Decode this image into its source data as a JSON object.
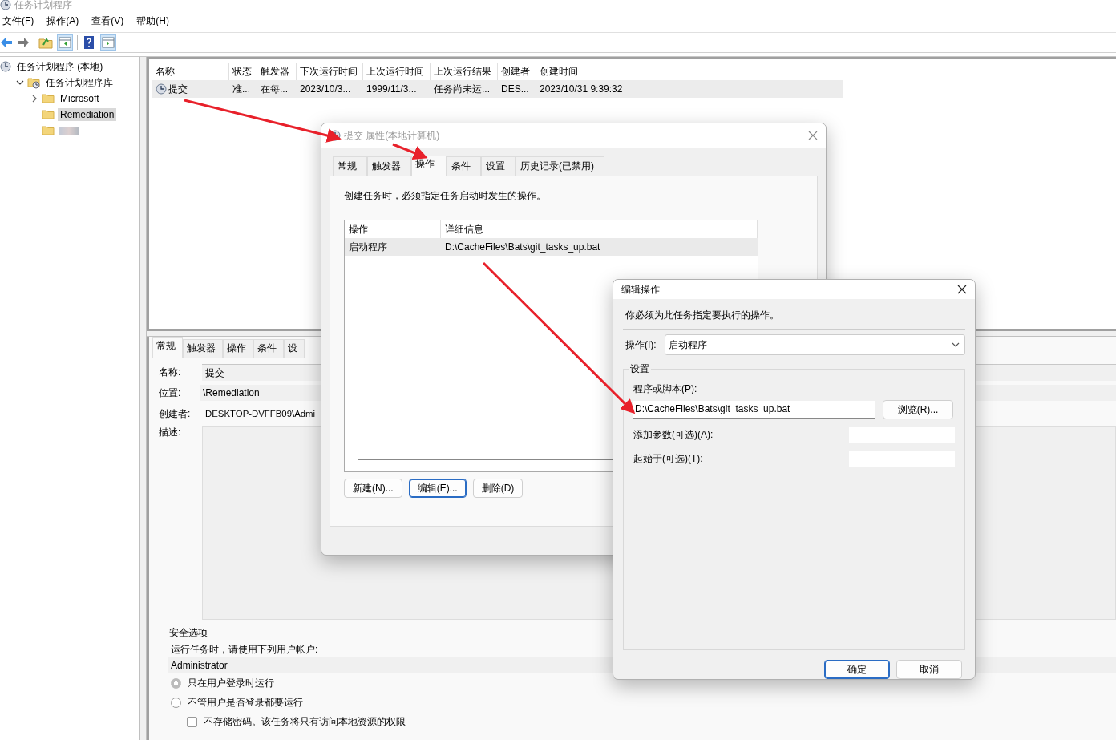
{
  "window": {
    "title": "任务计划程序"
  },
  "menu": [
    "文件(F)",
    "操作(A)",
    "查看(V)",
    "帮助(H)"
  ],
  "tree": [
    {
      "label": "任务计划程序 (本地)",
      "selected": false,
      "children": [
        {
          "label": "任务计划程序库",
          "selected": false,
          "expanded": true,
          "children": [
            {
              "label": "Microsoft",
              "selected": false,
              "expanded": false
            },
            {
              "label": "Remediation",
              "selected": true
            },
            {
              "kind": "redacted",
              "selected": false
            }
          ]
        }
      ]
    }
  ],
  "task_list": {
    "columns": [
      "名称",
      "状态",
      "触发器",
      "下次运行时间",
      "上次运行时间",
      "上次运行结果",
      "创建者",
      "创建时间"
    ],
    "rows": [
      {
        "cells": [
          "提交",
          "准...",
          "在每...",
          "2023/10/3...",
          "1999/11/3...",
          "任务尚未运...",
          "DES...",
          "2023/10/31 9:39:32"
        ],
        "selected": true
      }
    ]
  },
  "details": {
    "tabs": [
      {
        "label": "常规",
        "selected": true
      },
      {
        "label": "触发器",
        "selected": false
      },
      {
        "label": "操作",
        "selected": false
      },
      {
        "label": "条件",
        "selected": false
      },
      {
        "label": "设",
        "selected": false
      }
    ],
    "fields": [
      {
        "label": "名称:",
        "value": "提交",
        "kind": "field"
      },
      {
        "label": "位置:",
        "value": "\\Remediation",
        "kind": "text"
      },
      {
        "label": "创建者:",
        "value": "DESKTOP-DVFFB09\\Admi",
        "kind": "plain"
      },
      {
        "label": "描述:",
        "kind": "area"
      }
    ],
    "security": {
      "title": "安全选项",
      "prompt": "运行任务时，请使用下列用户帐户:",
      "account": "Administrator",
      "options": [
        {
          "label": "只在用户登录时运行",
          "selected": true
        },
        {
          "label": "不管用户是否登录都要运行",
          "selected": false
        }
      ],
      "no_store_password": {
        "label": "不存储密码。该任务将只有访问本地资源的权限",
        "checked": false
      }
    }
  },
  "properties_dialog": {
    "title": "提交 属性(本地计算机)",
    "tabs": [
      {
        "label": "常规",
        "selected": false
      },
      {
        "label": "触发器",
        "selected": false
      },
      {
        "label": "操作",
        "selected": true
      },
      {
        "label": "条件",
        "selected": false
      },
      {
        "label": "设置",
        "selected": false
      },
      {
        "label": "历史记录(已禁用)",
        "selected": false
      }
    ],
    "description": "创建任务时，必须指定任务启动时发生的操作。",
    "actions": {
      "columns": [
        "操作",
        "详细信息"
      ],
      "rows": [
        {
          "cells": [
            "启动程序",
            "D:\\CacheFiles\\Bats\\git_tasks_up.bat"
          ],
          "selected": true
        }
      ]
    },
    "buttons": [
      {
        "label": "新建(N)...",
        "default": false
      },
      {
        "label": "编辑(E)...",
        "default": true
      },
      {
        "label": "删除(D)",
        "default": false
      }
    ]
  },
  "edit_dialog": {
    "title": "编辑操作",
    "instruction": "你必须为此任务指定要执行的操作。",
    "action_label": "操作(I):",
    "action_value": "启动程序",
    "group_title": "设置",
    "program_label": "程序或脚本(P):",
    "program_value": "D:\\CacheFiles\\Bats\\git_tasks_up.bat",
    "browse": "浏览(R)...",
    "arguments_label": "添加参数(可选)(A):",
    "start_in_label": "起始于(可选)(T):",
    "buttons": [
      {
        "label": "确定",
        "default": true
      },
      {
        "label": "取消",
        "default": false
      }
    ]
  }
}
